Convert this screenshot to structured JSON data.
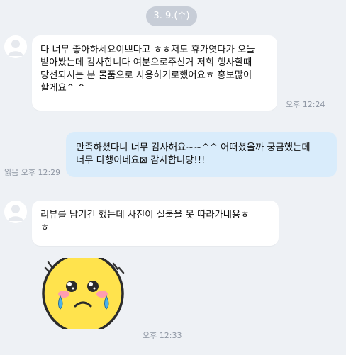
{
  "date_divider": "3. 9.(수)",
  "messages": [
    {
      "sender": "customer",
      "text": "다 너무 좋아하세요이쁘다고 ㅎㅎ저도 휴가엿다가 오늘\n받아봤는데 감사합니다 여분으로주신거 저희 행사할때\n당선되시는 분 물품으로 사용하기로했어요ㅎ 홍보많이\n할게요^ ^",
      "time": "오후 12:24"
    },
    {
      "sender": "seller",
      "text": "만족하셨다니 너무 감사해요~~^^ 어떠셨을까 궁금했는데\n너무 다행이네요⊠ 감사합니당!!!",
      "read_time": "읽음 오후 12:29"
    },
    {
      "sender": "customer",
      "text": "리뷰를 남기긴 했는데 사진이 실물을 못 따라가네용ㅎ\nㅎ",
      "time": ""
    },
    {
      "sender": "customer",
      "emoticon": "crying-face-sticker",
      "time": "오후 12:33"
    }
  ]
}
